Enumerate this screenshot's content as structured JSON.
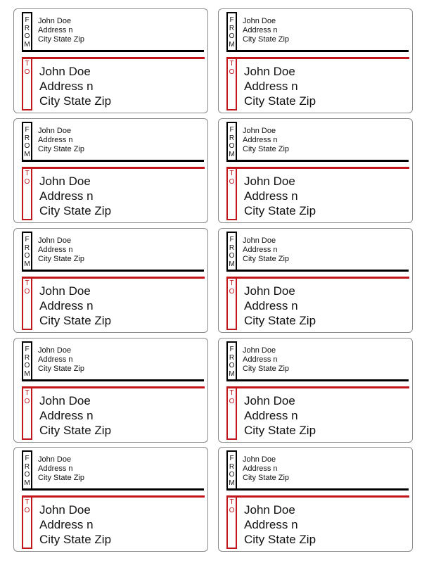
{
  "tags": {
    "from": [
      "F",
      "R",
      "O",
      "M"
    ],
    "to": [
      "T",
      "O"
    ]
  },
  "colors": {
    "accent": "#c0161c",
    "from_rule": "#000000",
    "border": "#8a8a8a"
  },
  "labels": [
    {
      "from": [
        "John Doe",
        "Address n",
        "City State Zip"
      ],
      "to": [
        "John Doe",
        "Address n",
        "City State Zip"
      ]
    },
    {
      "from": [
        "John Doe",
        "Address n",
        "City State Zip"
      ],
      "to": [
        "John Doe",
        "Address n",
        "City State Zip"
      ]
    },
    {
      "from": [
        "John Doe",
        "Address n",
        "City State Zip"
      ],
      "to": [
        "John Doe",
        "Address n",
        "City State Zip"
      ]
    },
    {
      "from": [
        "John Doe",
        "Address n",
        "City State Zip"
      ],
      "to": [
        "John Doe",
        "Address n",
        "City State Zip"
      ]
    },
    {
      "from": [
        "John Doe",
        "Address n",
        "City State Zip"
      ],
      "to": [
        "John Doe",
        "Address n",
        "City State Zip"
      ]
    },
    {
      "from": [
        "John Doe",
        "Address n",
        "City State Zip"
      ],
      "to": [
        "John Doe",
        "Address n",
        "City State Zip"
      ]
    },
    {
      "from": [
        "John Doe",
        "Address n",
        "City State Zip"
      ],
      "to": [
        "John Doe",
        "Address n",
        "City State Zip"
      ]
    },
    {
      "from": [
        "John Doe",
        "Address n",
        "City State Zip"
      ],
      "to": [
        "John Doe",
        "Address n",
        "City State Zip"
      ]
    },
    {
      "from": [
        "John Doe",
        "Address n",
        "City State Zip"
      ],
      "to": [
        "John Doe",
        "Address n",
        "City State Zip"
      ]
    },
    {
      "from": [
        "John Doe",
        "Address n",
        "City State Zip"
      ],
      "to": [
        "John Doe",
        "Address n",
        "City State Zip"
      ]
    }
  ]
}
